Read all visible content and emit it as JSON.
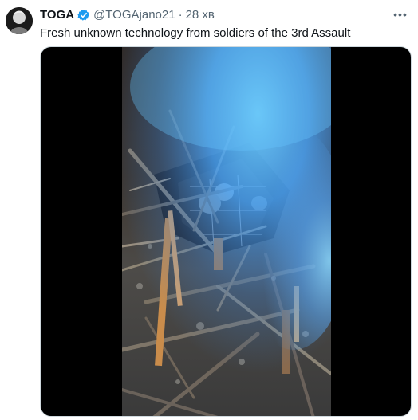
{
  "tweet": {
    "display_name": "TOGA",
    "handle": "@TOGAjano21",
    "separator": "·",
    "time": "28 хв",
    "more_glyph": "•••",
    "text": "Fresh unknown technology from soldiers of the 3rd Assault"
  },
  "icons": {
    "avatar": "user-avatar",
    "verified": "verified-badge-icon",
    "more": "more-options-icon"
  },
  "colors": {
    "verified": "#1d9bf0",
    "text_primary": "#0f1419",
    "text_secondary": "#536471",
    "media_background": "#000000",
    "smoke": "#58b8ff"
  }
}
